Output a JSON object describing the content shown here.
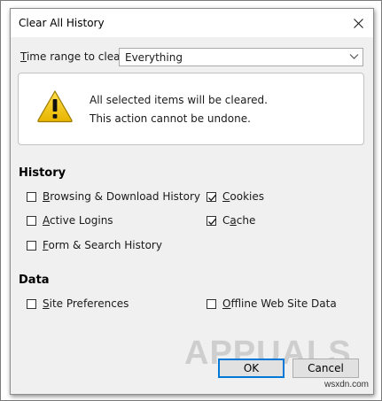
{
  "dialog": {
    "title": "Clear All History",
    "close_icon": "close-icon"
  },
  "range": {
    "label_mnemonic": "T",
    "label_rest": "ime range to clear:",
    "value": "Everything"
  },
  "warning": {
    "icon": "warning-icon",
    "line1": "All selected items will be cleared.",
    "line2": "This action cannot be undone."
  },
  "history": {
    "title": "History",
    "items": [
      {
        "pre": "",
        "mn": "B",
        "post": "rowsing & Download History",
        "checked": false
      },
      {
        "pre": "",
        "mn": "C",
        "post": "ookies",
        "checked": true
      },
      {
        "pre": "",
        "mn": "A",
        "post": "ctive Logins",
        "checked": false
      },
      {
        "pre": "C",
        "mn": "a",
        "post": "che",
        "checked": true
      },
      {
        "pre": "",
        "mn": "F",
        "post": "orm & Search History",
        "checked": false
      }
    ]
  },
  "data": {
    "title": "Data",
    "items": [
      {
        "pre": "",
        "mn": "S",
        "post": "ite Preferences",
        "checked": false
      },
      {
        "pre": "",
        "mn": "O",
        "post": "ffline Web Site Data",
        "checked": false
      }
    ]
  },
  "buttons": {
    "ok": "OK",
    "cancel": "Cancel"
  },
  "watermark": {
    "brand": "APPUALS",
    "site": "wsxdn.com"
  },
  "colors": {
    "accent": "#0078d7",
    "dialog_bg": "#f0f0f0",
    "warning_yellow": "#f2c200"
  }
}
